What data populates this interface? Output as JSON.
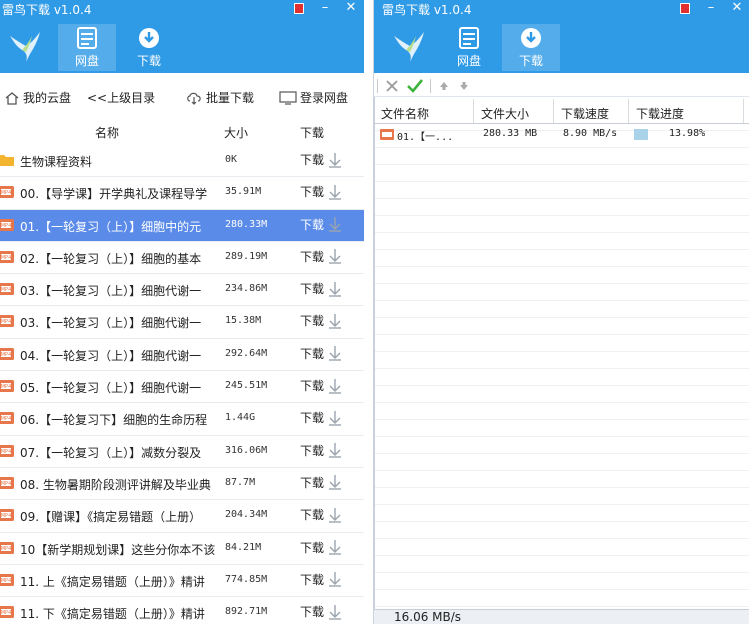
{
  "left": {
    "title": "雷鸟下载 v1.0.4",
    "nav": [
      {
        "label": "网盘"
      },
      {
        "label": "下载"
      }
    ],
    "toolbar": {
      "my_cloud": "我的云盘",
      "parent_dir": "<<上级目录",
      "batch_download": "批量下载",
      "login": "登录网盘"
    },
    "columns": {
      "name": "名称",
      "size": "大小",
      "download": "下载"
    },
    "rows": [
      {
        "name": "生物课程资料",
        "size": "0K",
        "action": "下载",
        "type": "folder"
      },
      {
        "name": "00.【导学课】开学典礼及课程导学",
        "size": "35.91M",
        "action": "下载",
        "type": "video"
      },
      {
        "name": "01.【一轮复习（上）】细胞中的元",
        "size": "280.33M",
        "action": "下载",
        "type": "video",
        "selected": true
      },
      {
        "name": "02.【一轮复习（上）】细胞的基本",
        "size": "289.19M",
        "action": "下载",
        "type": "video"
      },
      {
        "name": "03.【一轮复习（上）】细胞代谢一",
        "size": "234.86M",
        "action": "下载",
        "type": "video"
      },
      {
        "name": "03.【一轮复习（上）】细胞代谢一",
        "size": "15.38M",
        "action": "下载",
        "type": "video"
      },
      {
        "name": "04.【一轮复习（上）】细胞代谢一",
        "size": "292.64M",
        "action": "下载",
        "type": "video"
      },
      {
        "name": "05.【一轮复习（上）】细胞代谢一",
        "size": "245.51M",
        "action": "下载",
        "type": "video"
      },
      {
        "name": "06.【一轮复习下】细胞的生命历程",
        "size": "1.44G",
        "action": "下载",
        "type": "video"
      },
      {
        "name": "07.【一轮复习（上）】减数分裂及",
        "size": "316.06M",
        "action": "下载",
        "type": "video"
      },
      {
        "name": "08. 生物暑期阶段测评讲解及毕业典",
        "size": "87.7M",
        "action": "下载",
        "type": "video"
      },
      {
        "name": "09.【赠课】《搞定易错题（上册）",
        "size": "204.34M",
        "action": "下载",
        "type": "video"
      },
      {
        "name": "10【新学期规划课】这些分你本不该",
        "size": "84.21M",
        "action": "下载",
        "type": "video"
      },
      {
        "name": "11. 上《搞定易错题（上册）》精讲",
        "size": "774.85M",
        "action": "下载",
        "type": "video"
      },
      {
        "name": "11. 下《搞定易错题（上册）》精讲",
        "size": "892.71M",
        "action": "下载",
        "type": "video"
      }
    ]
  },
  "right": {
    "title": "雷鸟下载 v1.0.4",
    "nav": [
      {
        "label": "网盘"
      },
      {
        "label": "下载"
      }
    ],
    "columns": {
      "file_name": "文件名称",
      "file_size": "文件大小",
      "speed": "下载速度",
      "progress": "下载进度"
    },
    "downloads": [
      {
        "name": "01.【一...",
        "size": "280.33 MB",
        "speed": "8.90 MB/s",
        "progress": "13.98%",
        "progress_value": 0.1398
      }
    ],
    "status_speed": "16.06 MB/s"
  },
  "colors": {
    "header": "#2f9ae6",
    "selected_row": "#5b8be8",
    "confirm": "#3cb43c",
    "cancel": "#9a9a9a"
  },
  "icons": [
    "bird-logo-icon",
    "cloud-disk-icon",
    "download-icon",
    "home-icon",
    "cloud-download-icon",
    "monitor-icon",
    "folder-icon",
    "video-file-icon",
    "arrow-down-icon",
    "close-icon",
    "check-icon",
    "arrow-up-icon",
    "minimize-icon",
    "restore-icon"
  ]
}
